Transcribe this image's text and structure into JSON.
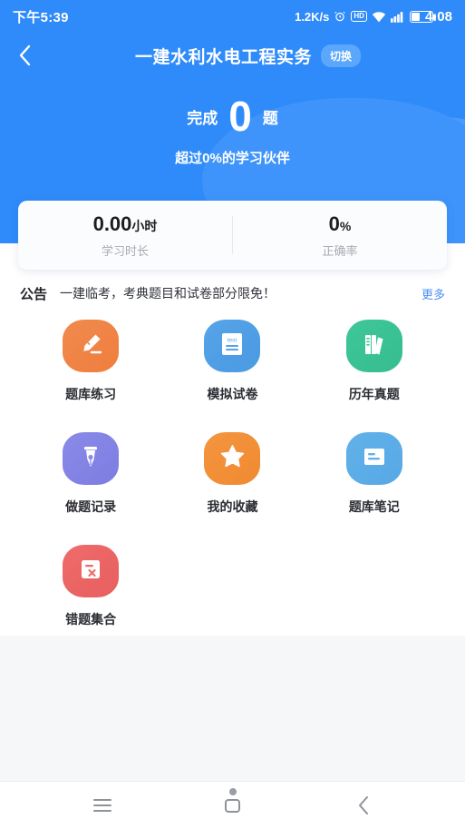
{
  "statusbar": {
    "time": "下午5:39",
    "network_speed": "1.2K/s",
    "alarm_icon": "alarm-icon",
    "hd_label": "HD",
    "wifi_icon": "wifi-icon",
    "signal_icon": "signal-icon",
    "battery_icon": "battery-icon",
    "clock": "4:08"
  },
  "header": {
    "back_icon": "back-chevron-icon",
    "title": "一建水利水电工程实务",
    "switch_label": "切换",
    "accent": "#2f8bf9"
  },
  "hero": {
    "prefix": "完成",
    "count": "0",
    "suffix": "题",
    "subtitle": "超过0%的学习伙伴"
  },
  "stats": [
    {
      "value": "0.00",
      "unit": "小时",
      "label": "学习时长"
    },
    {
      "value": "0",
      "unit": "%",
      "label": "正确率"
    }
  ],
  "notice": {
    "tag": "公告",
    "text": "一建临考，考典题目和试卷部分限免！",
    "more_label": "更多",
    "more_color": "#4a90f2"
  },
  "grid": [
    {
      "label": "题库练习",
      "icon": "pencil-icon",
      "color": "#f08a4e",
      "color2": "#ef7e3d"
    },
    {
      "label": "模拟试卷",
      "icon": "test-paper-icon",
      "color": "#56a3e8",
      "color2": "#4a9ae2"
    },
    {
      "label": "历年真题",
      "icon": "books-icon",
      "color": "#3fc79a",
      "color2": "#35bd90"
    },
    {
      "label": "做题记录",
      "icon": "fountain-pen-icon",
      "color": "#8a8ae8",
      "color2": "#7d7de2"
    },
    {
      "label": "我的收藏",
      "icon": "star-icon",
      "color": "#f4953f",
      "color2": "#ef8a31"
    },
    {
      "label": "题库笔记",
      "icon": "note-icon",
      "color": "#62b1ea",
      "color2": "#56a8e5"
    },
    {
      "label": "错题集合",
      "icon": "wrong-answer-icon",
      "color": "#ef6b6b",
      "color2": "#e85f5f"
    }
  ],
  "sysnav": {
    "recents_label": "recents-icon",
    "home_label": "home-icon",
    "back_label": "back-icon"
  }
}
